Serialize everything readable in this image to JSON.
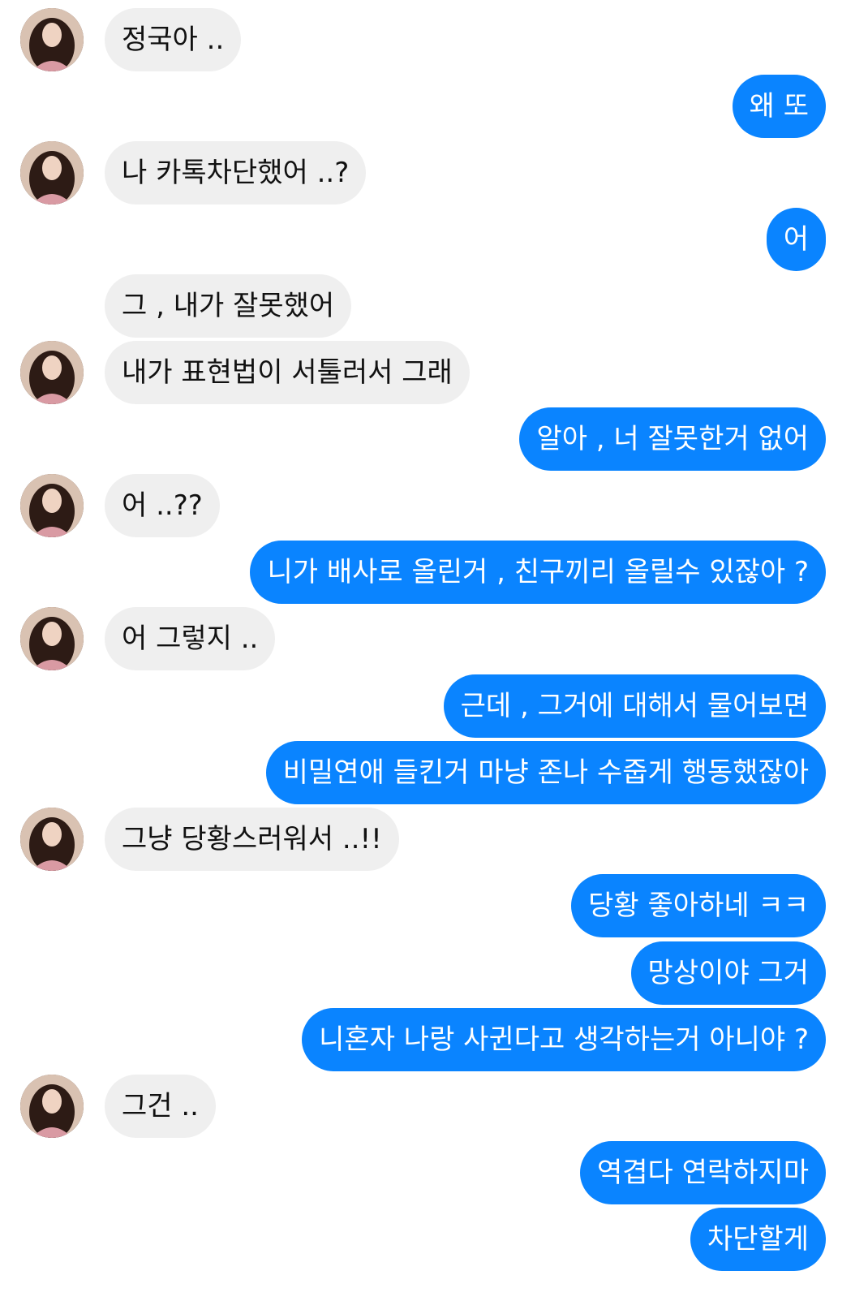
{
  "colors": {
    "incoming_bubble": "#efefef",
    "outgoing_bubble": "#0a84ff",
    "incoming_text": "#111111",
    "outgoing_text": "#ffffff"
  },
  "avatar": {
    "icon": "profile-photo-avatar"
  },
  "messages": [
    {
      "side": "incoming",
      "text": "정국아 .."
    },
    {
      "side": "outgoing",
      "text": "왜 또"
    },
    {
      "side": "incoming",
      "text": "나 카톡차단했어 ..?"
    },
    {
      "side": "outgoing",
      "text": "어"
    },
    {
      "side": "incoming",
      "text": "그 , 내가 잘못했어"
    },
    {
      "side": "incoming",
      "text": "내가 표현법이 서툴러서 그래"
    },
    {
      "side": "outgoing",
      "text": "알아 , 너 잘못한거 없어"
    },
    {
      "side": "incoming",
      "text": "어 ..??"
    },
    {
      "side": "outgoing",
      "text": "니가 배사로 올린거 , 친구끼리 올릴수 있잖아 ?"
    },
    {
      "side": "incoming",
      "text": "어 그렇지 .."
    },
    {
      "side": "outgoing",
      "text": "근데 , 그거에 대해서 물어보면"
    },
    {
      "side": "outgoing",
      "text": "비밀연애 들킨거 마냥 존나 수줍게 행동했잖아"
    },
    {
      "side": "incoming",
      "text": "그냥 당황스러워서 ..!!"
    },
    {
      "side": "outgoing",
      "text": "당황 좋아하네 ㅋㅋ"
    },
    {
      "side": "outgoing",
      "text": "망상이야 그거"
    },
    {
      "side": "outgoing",
      "text": "니혼자 나랑 사귄다고 생각하는거 아니야 ?"
    },
    {
      "side": "incoming",
      "text": "그건 .."
    },
    {
      "side": "outgoing",
      "text": "역겹다 연락하지마"
    },
    {
      "side": "outgoing",
      "text": "차단할게"
    }
  ]
}
